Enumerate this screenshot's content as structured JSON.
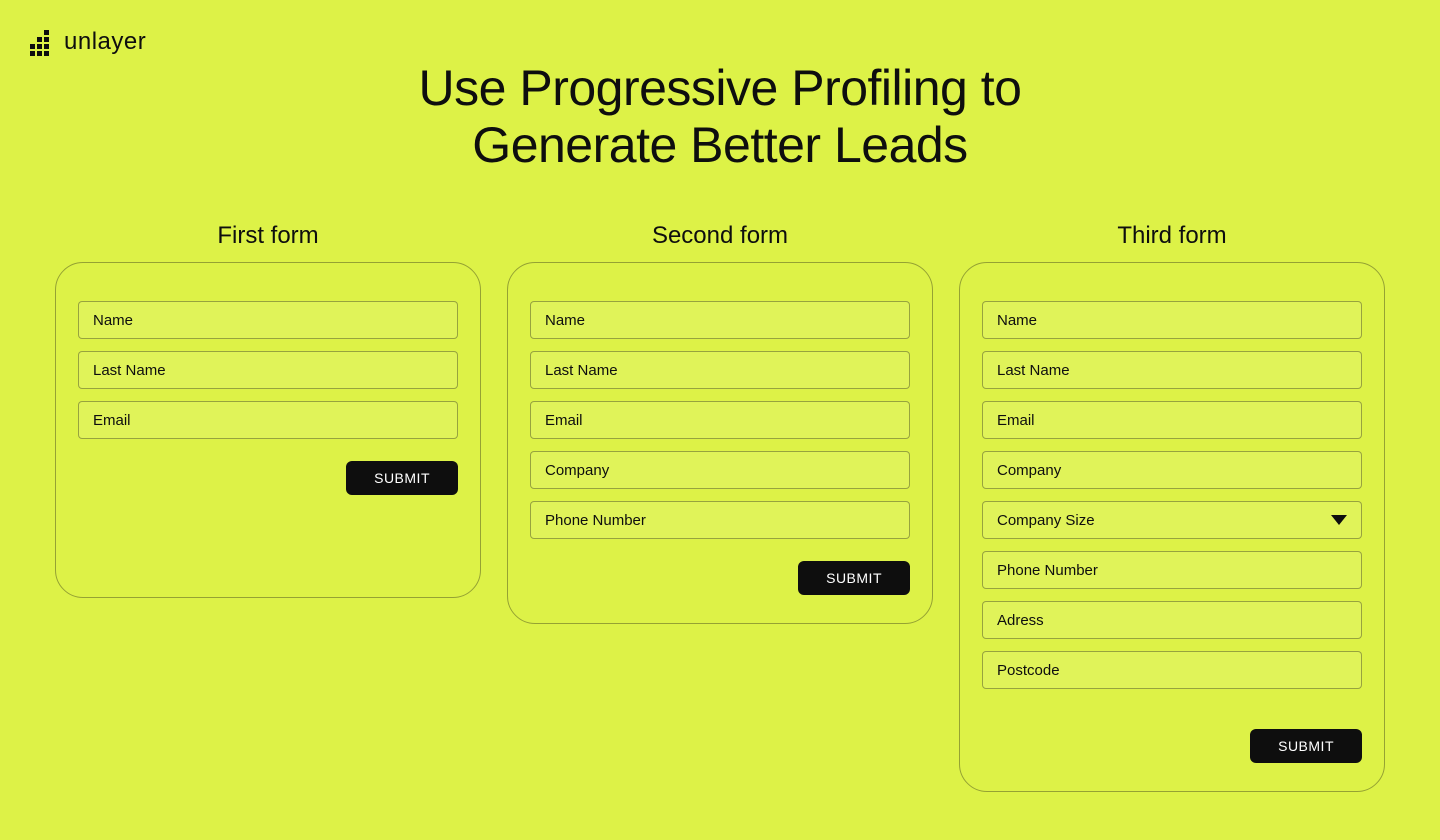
{
  "brand": {
    "name": "unlayer"
  },
  "title_line1": "Use Progressive Profiling to",
  "title_line2": "Generate Better Leads",
  "forms": {
    "first": {
      "heading": "First form",
      "fields": {
        "name": "Name",
        "last_name": "Last Name",
        "email": "Email"
      },
      "submit": "SUBMIT"
    },
    "second": {
      "heading": "Second form",
      "fields": {
        "name": "Name",
        "last_name": "Last Name",
        "email": "Email",
        "company": "Company",
        "phone": "Phone Number"
      },
      "submit": "SUBMIT"
    },
    "third": {
      "heading": "Third form",
      "fields": {
        "name": "Name",
        "last_name": "Last Name",
        "email": "Email",
        "company": "Company",
        "company_size": "Company Size",
        "phone": "Phone Number",
        "address": "Adress",
        "postcode": "Postcode"
      },
      "submit": "SUBMIT"
    }
  }
}
